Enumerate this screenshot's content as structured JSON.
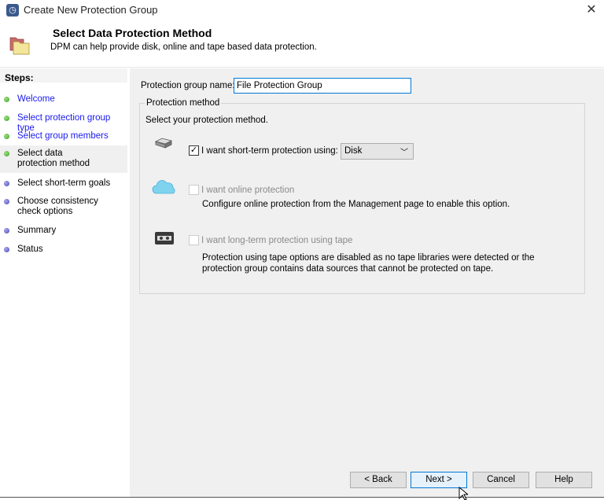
{
  "window": {
    "title": "Create New Protection Group",
    "close": "✕"
  },
  "header": {
    "title": "Select Data Protection Method",
    "subtitle": "DPM can help provide disk, online and tape based data protection."
  },
  "sidebar": {
    "heading": "Steps:",
    "items": [
      {
        "label": "Welcome",
        "status": "done"
      },
      {
        "label": "Select protection group type",
        "status": "done"
      },
      {
        "label": "Select group members",
        "status": "done"
      },
      {
        "label": "Select data protection method",
        "status": "current"
      },
      {
        "label": "Select short-term goals",
        "status": "pending"
      },
      {
        "label": "Choose consistency check options",
        "status": "pending"
      },
      {
        "label": "Summary",
        "status": "pending"
      },
      {
        "label": "Status",
        "status": "pending"
      }
    ]
  },
  "form": {
    "name_label": "Protection group name:",
    "name_value": "File Protection Group",
    "method_legend": "Protection method",
    "method_prompt": "Select your protection method.",
    "short_term": {
      "label": "I want short-term protection using:",
      "checked": true,
      "check": "✓",
      "selected": "Disk"
    },
    "online": {
      "label": "I want online protection",
      "checked": false,
      "note": "Configure online protection from the Management page to enable this option."
    },
    "tape": {
      "label": "I want long-term protection using tape",
      "checked": false,
      "note_line1": "Protection using tape options are disabled as no tape libraries were detected or the",
      "note_line2": "protection group contains data sources that cannot be protected on tape."
    }
  },
  "buttons": {
    "back": "< Back",
    "next": "Next >",
    "cancel": "Cancel",
    "help": "Help"
  }
}
